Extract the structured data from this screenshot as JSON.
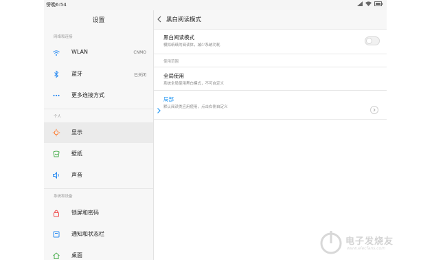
{
  "status": {
    "time": "傍晚6:54",
    "icons": [
      "signal-icon",
      "wifi-icon",
      "battery-icon"
    ]
  },
  "sidebar": {
    "title": "设置",
    "sections": {
      "network": "网络和连接",
      "personal": "个人",
      "system": "系统和设备"
    },
    "items": [
      {
        "label": "WLAN",
        "value": "CNMO",
        "icon": "wifi-icon"
      },
      {
        "label": "蓝牙",
        "value": "已关闭",
        "icon": "bluetooth-icon"
      },
      {
        "label": "更多连接方式",
        "value": "",
        "icon": "more-icon"
      },
      {
        "label": "显示",
        "value": "",
        "icon": "display-icon",
        "selected": true
      },
      {
        "label": "壁纸",
        "value": "",
        "icon": "wallpaper-icon"
      },
      {
        "label": "声音",
        "value": "",
        "icon": "sound-icon"
      },
      {
        "label": "锁屏和密码",
        "value": "",
        "icon": "lock-icon"
      },
      {
        "label": "通知和状态栏",
        "value": "",
        "icon": "notification-icon"
      },
      {
        "label": "桌面",
        "value": "",
        "icon": "home-icon"
      }
    ]
  },
  "content": {
    "title": "黑白阅读模式",
    "toggle_row": {
      "title": "黑白阅读模式",
      "subtitle": "模拟纸纸的阅读体，减少系统功耗",
      "on": false
    },
    "range_label": "使用范围",
    "options": [
      {
        "title": "全局使用",
        "subtitle": "系统全局使用黑白模式，不可自定义",
        "selected": false
      },
      {
        "title": "局部",
        "subtitle": "默认阅读类应用使用，点击右侧自定义",
        "selected": true
      }
    ]
  },
  "watermark": {
    "text": "电子发烧友",
    "sub": "www.elecfans.com"
  },
  "colors": {
    "accent": "#2196f3",
    "orange": "#ff7b2e",
    "green": "#4caf50",
    "red": "#f04848",
    "blue": "#2a8bf2"
  }
}
